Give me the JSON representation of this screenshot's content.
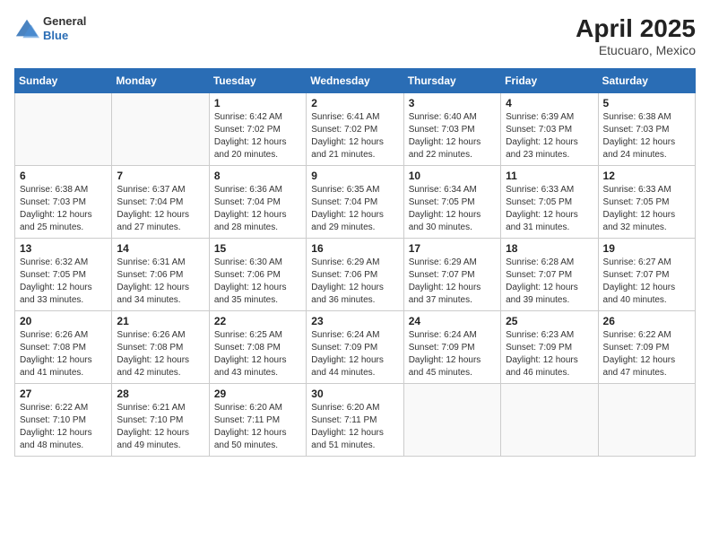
{
  "header": {
    "logo": {
      "general": "General",
      "blue": "Blue"
    },
    "title": "April 2025",
    "location": "Etucuaro, Mexico"
  },
  "days_of_week": [
    "Sunday",
    "Monday",
    "Tuesday",
    "Wednesday",
    "Thursday",
    "Friday",
    "Saturday"
  ],
  "weeks": [
    [
      {
        "day": "",
        "sunrise": "",
        "sunset": "",
        "daylight": ""
      },
      {
        "day": "",
        "sunrise": "",
        "sunset": "",
        "daylight": ""
      },
      {
        "day": "1",
        "sunrise": "Sunrise: 6:42 AM",
        "sunset": "Sunset: 7:02 PM",
        "daylight": "Daylight: 12 hours and 20 minutes."
      },
      {
        "day": "2",
        "sunrise": "Sunrise: 6:41 AM",
        "sunset": "Sunset: 7:02 PM",
        "daylight": "Daylight: 12 hours and 21 minutes."
      },
      {
        "day": "3",
        "sunrise": "Sunrise: 6:40 AM",
        "sunset": "Sunset: 7:03 PM",
        "daylight": "Daylight: 12 hours and 22 minutes."
      },
      {
        "day": "4",
        "sunrise": "Sunrise: 6:39 AM",
        "sunset": "Sunset: 7:03 PM",
        "daylight": "Daylight: 12 hours and 23 minutes."
      },
      {
        "day": "5",
        "sunrise": "Sunrise: 6:38 AM",
        "sunset": "Sunset: 7:03 PM",
        "daylight": "Daylight: 12 hours and 24 minutes."
      }
    ],
    [
      {
        "day": "6",
        "sunrise": "Sunrise: 6:38 AM",
        "sunset": "Sunset: 7:03 PM",
        "daylight": "Daylight: 12 hours and 25 minutes."
      },
      {
        "day": "7",
        "sunrise": "Sunrise: 6:37 AM",
        "sunset": "Sunset: 7:04 PM",
        "daylight": "Daylight: 12 hours and 27 minutes."
      },
      {
        "day": "8",
        "sunrise": "Sunrise: 6:36 AM",
        "sunset": "Sunset: 7:04 PM",
        "daylight": "Daylight: 12 hours and 28 minutes."
      },
      {
        "day": "9",
        "sunrise": "Sunrise: 6:35 AM",
        "sunset": "Sunset: 7:04 PM",
        "daylight": "Daylight: 12 hours and 29 minutes."
      },
      {
        "day": "10",
        "sunrise": "Sunrise: 6:34 AM",
        "sunset": "Sunset: 7:05 PM",
        "daylight": "Daylight: 12 hours and 30 minutes."
      },
      {
        "day": "11",
        "sunrise": "Sunrise: 6:33 AM",
        "sunset": "Sunset: 7:05 PM",
        "daylight": "Daylight: 12 hours and 31 minutes."
      },
      {
        "day": "12",
        "sunrise": "Sunrise: 6:33 AM",
        "sunset": "Sunset: 7:05 PM",
        "daylight": "Daylight: 12 hours and 32 minutes."
      }
    ],
    [
      {
        "day": "13",
        "sunrise": "Sunrise: 6:32 AM",
        "sunset": "Sunset: 7:05 PM",
        "daylight": "Daylight: 12 hours and 33 minutes."
      },
      {
        "day": "14",
        "sunrise": "Sunrise: 6:31 AM",
        "sunset": "Sunset: 7:06 PM",
        "daylight": "Daylight: 12 hours and 34 minutes."
      },
      {
        "day": "15",
        "sunrise": "Sunrise: 6:30 AM",
        "sunset": "Sunset: 7:06 PM",
        "daylight": "Daylight: 12 hours and 35 minutes."
      },
      {
        "day": "16",
        "sunrise": "Sunrise: 6:29 AM",
        "sunset": "Sunset: 7:06 PM",
        "daylight": "Daylight: 12 hours and 36 minutes."
      },
      {
        "day": "17",
        "sunrise": "Sunrise: 6:29 AM",
        "sunset": "Sunset: 7:07 PM",
        "daylight": "Daylight: 12 hours and 37 minutes."
      },
      {
        "day": "18",
        "sunrise": "Sunrise: 6:28 AM",
        "sunset": "Sunset: 7:07 PM",
        "daylight": "Daylight: 12 hours and 39 minutes."
      },
      {
        "day": "19",
        "sunrise": "Sunrise: 6:27 AM",
        "sunset": "Sunset: 7:07 PM",
        "daylight": "Daylight: 12 hours and 40 minutes."
      }
    ],
    [
      {
        "day": "20",
        "sunrise": "Sunrise: 6:26 AM",
        "sunset": "Sunset: 7:08 PM",
        "daylight": "Daylight: 12 hours and 41 minutes."
      },
      {
        "day": "21",
        "sunrise": "Sunrise: 6:26 AM",
        "sunset": "Sunset: 7:08 PM",
        "daylight": "Daylight: 12 hours and 42 minutes."
      },
      {
        "day": "22",
        "sunrise": "Sunrise: 6:25 AM",
        "sunset": "Sunset: 7:08 PM",
        "daylight": "Daylight: 12 hours and 43 minutes."
      },
      {
        "day": "23",
        "sunrise": "Sunrise: 6:24 AM",
        "sunset": "Sunset: 7:09 PM",
        "daylight": "Daylight: 12 hours and 44 minutes."
      },
      {
        "day": "24",
        "sunrise": "Sunrise: 6:24 AM",
        "sunset": "Sunset: 7:09 PM",
        "daylight": "Daylight: 12 hours and 45 minutes."
      },
      {
        "day": "25",
        "sunrise": "Sunrise: 6:23 AM",
        "sunset": "Sunset: 7:09 PM",
        "daylight": "Daylight: 12 hours and 46 minutes."
      },
      {
        "day": "26",
        "sunrise": "Sunrise: 6:22 AM",
        "sunset": "Sunset: 7:09 PM",
        "daylight": "Daylight: 12 hours and 47 minutes."
      }
    ],
    [
      {
        "day": "27",
        "sunrise": "Sunrise: 6:22 AM",
        "sunset": "Sunset: 7:10 PM",
        "daylight": "Daylight: 12 hours and 48 minutes."
      },
      {
        "day": "28",
        "sunrise": "Sunrise: 6:21 AM",
        "sunset": "Sunset: 7:10 PM",
        "daylight": "Daylight: 12 hours and 49 minutes."
      },
      {
        "day": "29",
        "sunrise": "Sunrise: 6:20 AM",
        "sunset": "Sunset: 7:11 PM",
        "daylight": "Daylight: 12 hours and 50 minutes."
      },
      {
        "day": "30",
        "sunrise": "Sunrise: 6:20 AM",
        "sunset": "Sunset: 7:11 PM",
        "daylight": "Daylight: 12 hours and 51 minutes."
      },
      {
        "day": "",
        "sunrise": "",
        "sunset": "",
        "daylight": ""
      },
      {
        "day": "",
        "sunrise": "",
        "sunset": "",
        "daylight": ""
      },
      {
        "day": "",
        "sunrise": "",
        "sunset": "",
        "daylight": ""
      }
    ]
  ]
}
